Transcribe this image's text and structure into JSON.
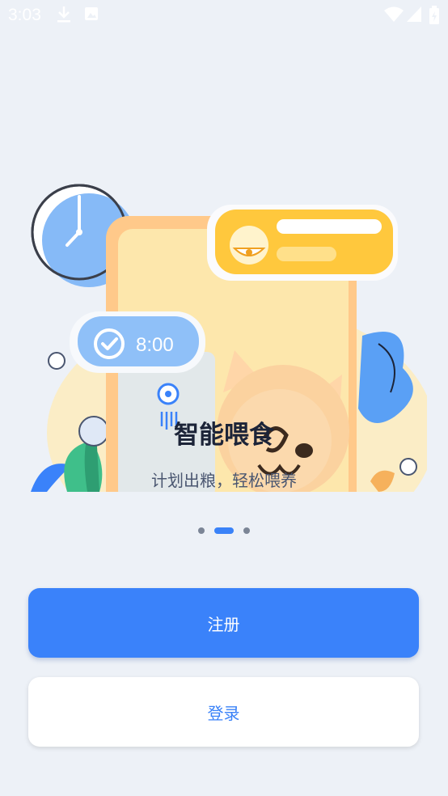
{
  "status_bar": {
    "time": "3:03"
  },
  "slide": {
    "title": "智能喂食",
    "subtitle": "计划出粮，轻松喂养",
    "badge_time": "8:00"
  },
  "pager": {
    "count": 3,
    "active_index": 1
  },
  "buttons": {
    "register": "注册",
    "login": "登录"
  },
  "colors": {
    "primary": "#3a82fa",
    "background": "#edf1f7",
    "accent_yellow": "#ffc83d"
  }
}
